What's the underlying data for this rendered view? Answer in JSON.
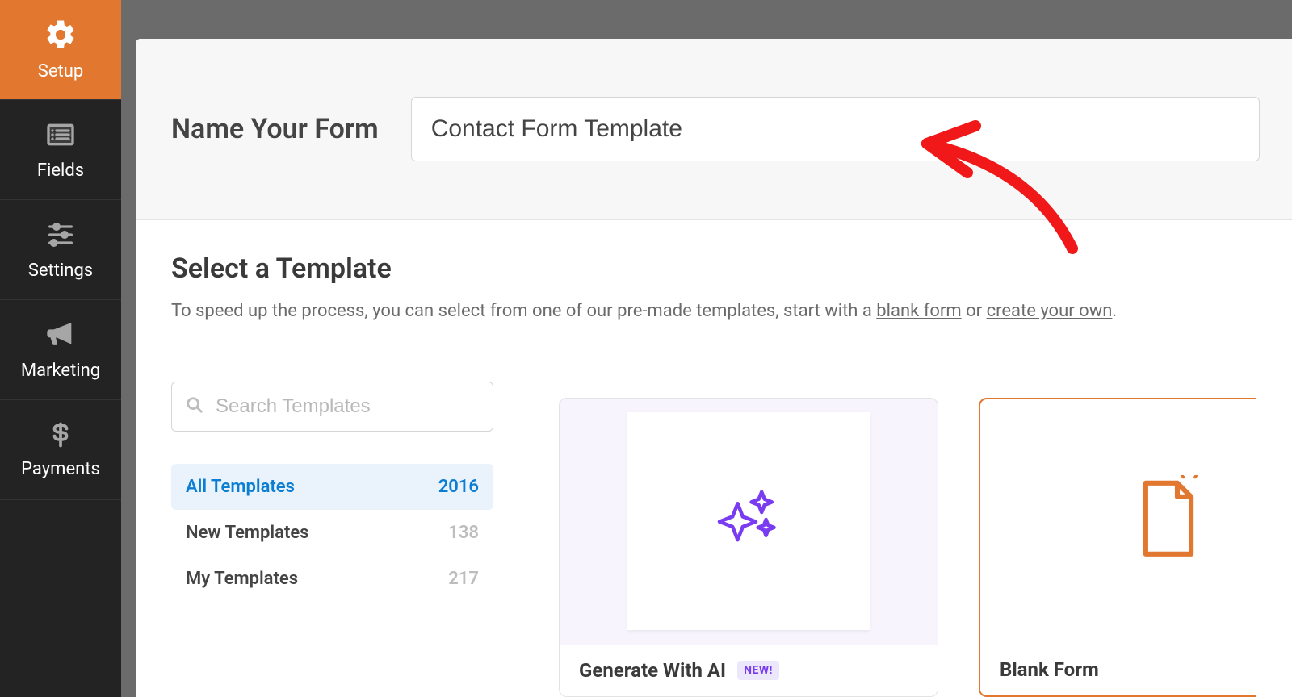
{
  "sidebar": {
    "items": [
      {
        "label": "Setup"
      },
      {
        "label": "Fields"
      },
      {
        "label": "Settings"
      },
      {
        "label": "Marketing"
      },
      {
        "label": "Payments"
      }
    ]
  },
  "name_section": {
    "label": "Name Your Form",
    "value": "Contact Form Template"
  },
  "template_section": {
    "heading": "Select a Template",
    "subtext_pre": "To speed up the process, you can select from one of our pre-made templates, start with a ",
    "link_blank": "blank form",
    "subtext_mid": " or ",
    "link_create": "create your own",
    "subtext_post": "."
  },
  "search": {
    "placeholder": "Search Templates"
  },
  "categories": [
    {
      "label": "All Templates",
      "count": "2016",
      "active": true
    },
    {
      "label": "New Templates",
      "count": "138",
      "active": false
    },
    {
      "label": "My Templates",
      "count": "217",
      "active": false
    }
  ],
  "cards": {
    "ai": {
      "title": "Generate With AI",
      "badge": "NEW!"
    },
    "blank": {
      "title": "Blank Form"
    }
  }
}
